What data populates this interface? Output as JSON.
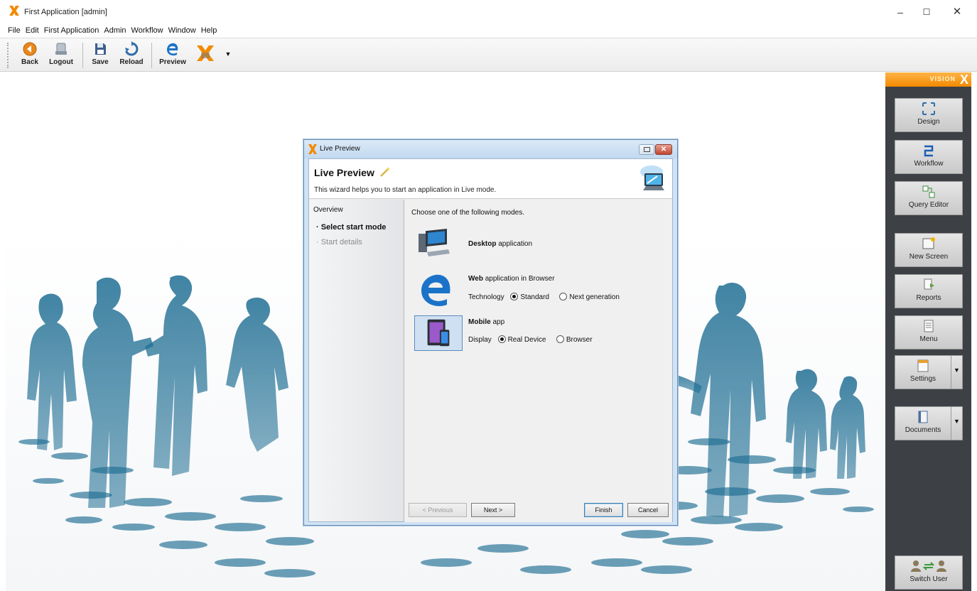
{
  "window": {
    "title": "First Application [admin]",
    "minimize": "–",
    "maximize": "☐",
    "close": "✕"
  },
  "menu": [
    "File",
    "Edit",
    "First Application",
    "Admin",
    "Workflow",
    "Window",
    "Help"
  ],
  "toolbar": {
    "back": "Back",
    "logout": "Logout",
    "save": "Save",
    "reload": "Reload",
    "preview": "Preview"
  },
  "right_panel": {
    "brand": "VISION",
    "brand_x": "X",
    "design": "Design",
    "workflow": "Workflow",
    "query_editor": "Query Editor",
    "new_screen": "New Screen",
    "reports": "Reports",
    "menu": "Menu",
    "settings": "Settings",
    "documents": "Documents",
    "switch_user": "Switch User"
  },
  "dialog": {
    "window_title": "Live Preview",
    "heading": "Live Preview",
    "subtitle": "This wizard helps you to start an application in Live mode.",
    "close_glyph": "✕",
    "steps": {
      "overview": "Overview",
      "select_start_mode": "·  Select start mode",
      "start_details": "·  Start details"
    },
    "intro": "Choose one of the following modes.",
    "desktop": {
      "bold": "Desktop",
      "rest": " application"
    },
    "web": {
      "bold": "Web",
      "rest": " application in Browser",
      "option_label": "Technology",
      "options": [
        "Standard",
        "Next generation"
      ],
      "selected": "Standard"
    },
    "mobile": {
      "bold": "Mobile",
      "rest": " app",
      "option_label": "Display",
      "options": [
        "Real Device",
        "Browser"
      ],
      "selected": "Real Device"
    },
    "buttons": {
      "previous": "< Previous",
      "next": "Next >",
      "finish": "Finish",
      "cancel": "Cancel"
    }
  },
  "colors": {
    "brand_orange": "#f28a00",
    "panel_dark": "#3d4146",
    "silhouette_teal": "#1f6e93",
    "dialog_frame": "#cfe3f5"
  }
}
